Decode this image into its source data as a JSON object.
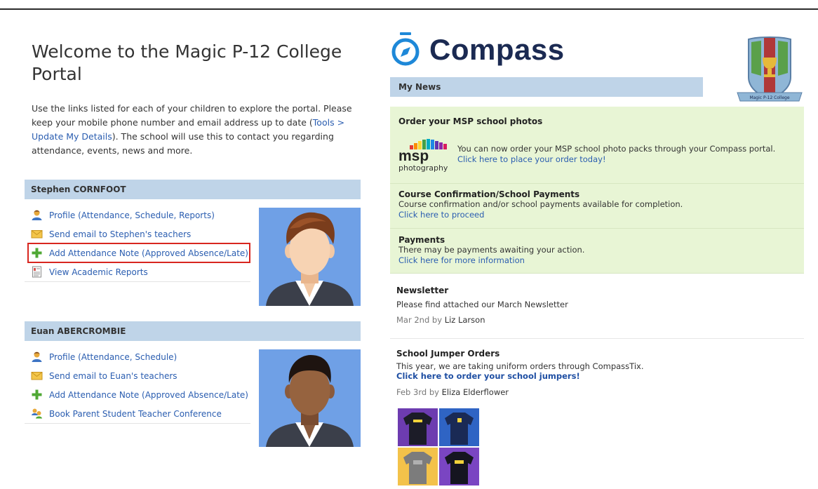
{
  "welcome": {
    "title": "Welcome to the Magic P-12 College Portal",
    "intro_before": "Use the links listed for each of your children to explore the portal. Please keep your mobile phone number and email address up to date (",
    "intro_link": "Tools > Update My Details",
    "intro_after": "). The school will use this to contact you regarding attendance, events, news and more."
  },
  "children": [
    {
      "name": "Stephen CORNFOOT",
      "links": [
        {
          "label": "Profile (Attendance, Schedule, Reports)",
          "icon": "profile-icon"
        },
        {
          "label": "Send email to Stephen's teachers",
          "icon": "email-icon"
        },
        {
          "label": "Add Attendance Note (Approved Absence/Late)",
          "icon": "add-icon"
        },
        {
          "label": "View Academic Reports",
          "icon": "report-icon"
        }
      ]
    },
    {
      "name": "Euan ABERCROMBIE",
      "links": [
        {
          "label": "Profile (Attendance, Schedule)",
          "icon": "profile-icon"
        },
        {
          "label": "Send email to Euan's teachers",
          "icon": "email-icon"
        },
        {
          "label": "Add Attendance Note (Approved Absence/Late)",
          "icon": "add-icon"
        },
        {
          "label": "Book Parent Student Teacher Conference",
          "icon": "conference-icon"
        }
      ]
    }
  ],
  "brand": {
    "name": "Compass",
    "crest_text": "Magic P-12 College"
  },
  "news": {
    "header": "My News",
    "msp": {
      "title": "Order your MSP school photos",
      "logo_word": "msp",
      "logo_sub": "photography",
      "text": "You can now order your MSP school photo packs through your Compass portal.",
      "link": "Click here to place your order today!"
    },
    "course": {
      "title": "Course Confirmation/School Payments",
      "text": "Course confirmation and/or school payments available for completion.",
      "link": "Click here to proceed"
    },
    "payments": {
      "title": "Payments",
      "text": "There may be payments awaiting your action.",
      "link": "Click here for more information"
    },
    "newsletter": {
      "title": "Newsletter",
      "text": "Please find attached our March Newsletter",
      "date": "Mar 2nd by",
      "author": "Liz Larson"
    },
    "jumpers": {
      "title": "School Jumper Orders",
      "text": "This year, we are taking uniform orders through CompassTix.",
      "link": "Click here to order your school jumpers!",
      "date": "Feb 3rd by",
      "author": "Eliza Elderflower"
    }
  },
  "colors": {
    "link": "#2a5db0",
    "section_header": "#bfd4e8",
    "news_green": "#e8f5d5",
    "highlight_border": "#d8261f",
    "compass_navy": "#1b2a52",
    "compass_blue": "#1e88d8",
    "avatar_bg": "#6fa0e6"
  }
}
